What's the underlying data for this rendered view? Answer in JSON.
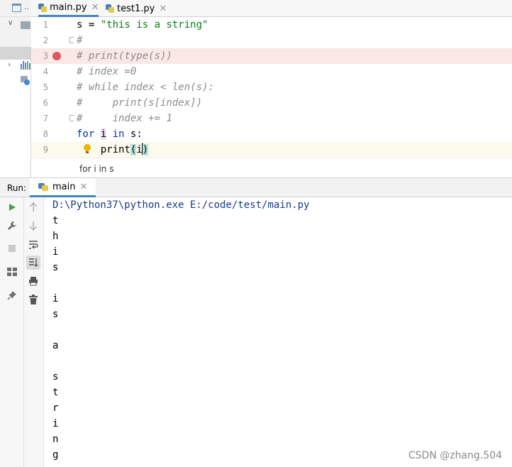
{
  "project_panel": {
    "tab_label": ".."
  },
  "editor_tabs": [
    {
      "label": "main.py",
      "active": true
    },
    {
      "label": "test1.py",
      "active": false
    }
  ],
  "editor": {
    "lines": [
      {
        "num": "1",
        "text": "s = \"this is a string\""
      },
      {
        "num": "2",
        "text": "#"
      },
      {
        "num": "3",
        "text": "# print(type(s))",
        "breakpoint": true
      },
      {
        "num": "4",
        "text": "# index =0"
      },
      {
        "num": "5",
        "text": "# while index < len(s):"
      },
      {
        "num": "6",
        "text": "#     print(s[index])"
      },
      {
        "num": "7",
        "text": "#     index += 1"
      },
      {
        "num": "8",
        "text": "for i in s:"
      },
      {
        "num": "9",
        "text": "    print(i)",
        "current": true
      }
    ],
    "breadcrumb": "for i in s"
  },
  "run": {
    "label": "Run:",
    "tab_label": "main",
    "console_lines": [
      "D:\\Python37\\python.exe E:/code/test/main.py",
      "t",
      "h",
      "i",
      "s",
      "",
      "i",
      "s",
      "",
      "a",
      "",
      "s",
      "t",
      "r",
      "i",
      "n",
      "g"
    ]
  },
  "watermark": "CSDN @zhang.504",
  "colors": {
    "accent": "#4083c9",
    "breakpoint": "#db5860",
    "keyword": "#0033b3",
    "string": "#067d17",
    "comment": "#8c8c8c"
  },
  "icons": {
    "run_toolbar": [
      "run-icon",
      "wrench-icon",
      "stop-icon",
      "layout-icon",
      "pin-icon"
    ],
    "console_toolbar": [
      "arrow-up-icon",
      "arrow-down-icon",
      "soft-wrap-icon",
      "scroll-to-end-icon",
      "print-icon",
      "trash-icon"
    ]
  }
}
